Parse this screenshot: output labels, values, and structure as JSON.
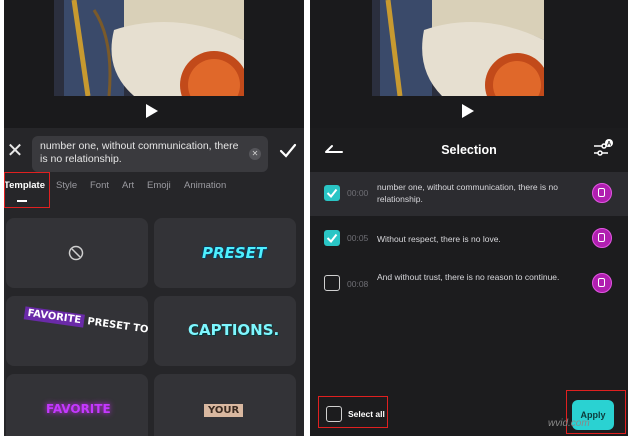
{
  "left": {
    "caption_text": "number one, without communication, there is no relationship.",
    "tabs": [
      {
        "label": "Template",
        "active": true
      },
      {
        "label": "Style",
        "active": false
      },
      {
        "label": "Font",
        "active": false
      },
      {
        "label": "Art",
        "active": false
      },
      {
        "label": "Emoji",
        "active": false
      },
      {
        "label": "Animation",
        "active": false
      }
    ],
    "presets": {
      "none_icon": "no-preset-icon",
      "preset": "PRESET",
      "favorite": "FAVORITE",
      "favorite_rest": "PRESET TO",
      "captions": "CAPTIONS.",
      "favorite_bottom": "FAVORITE",
      "your": "YOUR"
    }
  },
  "right": {
    "title": "Selection",
    "rows": [
      {
        "time": "00:00",
        "text": "number one, without communication, there is no relationship.",
        "checked": true
      },
      {
        "time": "00:05",
        "text": "Without respect, there is no love.",
        "checked": true
      },
      {
        "time": "00:08",
        "text": "And without trust, there is no reason to continue.",
        "checked": false
      }
    ],
    "select_all_label": "Select all",
    "apply_label": "Apply",
    "watermark": "wvid.com"
  },
  "colors": {
    "accent": "#2ac5c5",
    "highlight_box": "#e02020",
    "style_icon": "#b01fb0"
  }
}
